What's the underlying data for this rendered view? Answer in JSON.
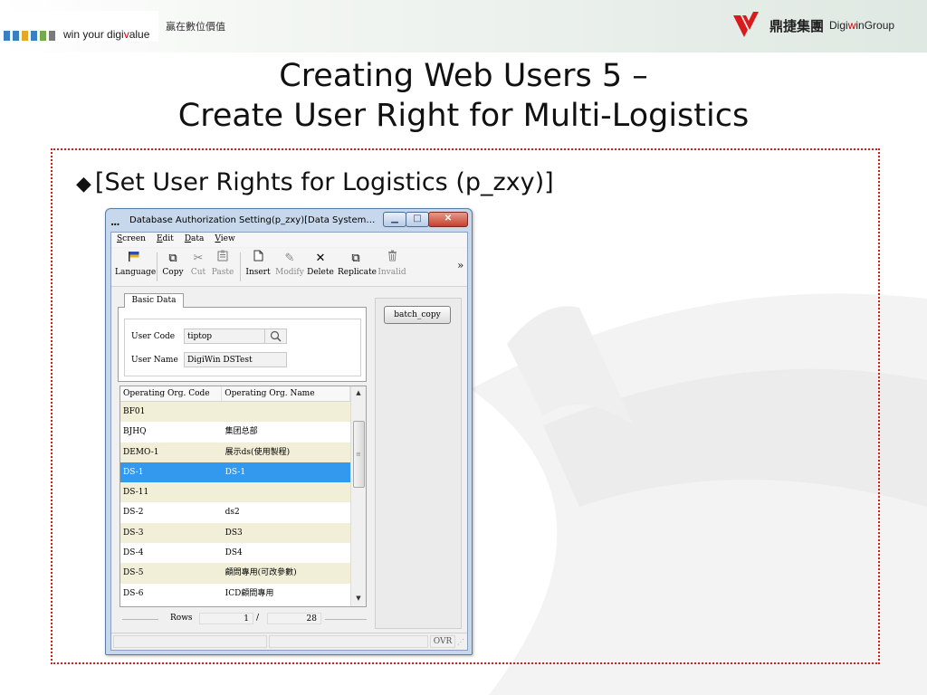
{
  "header": {
    "tagline_prefix": "win your digi",
    "tagline_highlight": "v",
    "tagline_suffix": "alue",
    "tagline_cn": "贏在數位價值",
    "brand_cn": "鼎捷集團",
    "brand_en_prefix": "Digi",
    "brand_en_highlight": "w",
    "brand_en_suffix": "inGroup",
    "square_colors": [
      "#3a7fc2",
      "#3a7fc2",
      "#e3a826",
      "#3a7fc2",
      "#76a84c",
      "#7a7a7a"
    ]
  },
  "slide": {
    "title_line1": "Creating Web Users 5 –",
    "title_line2": "Create User Right for Multi-Logistics",
    "bullet_symbol": "◆",
    "bullet_text": "[Set User Rights for Logistics (p_zxy)]"
  },
  "window": {
    "title_icon": "...",
    "title": "Database Authorization Setting(p_zxy)[Data Systems]...",
    "menu": [
      {
        "key": "S",
        "rest": "creen"
      },
      {
        "key": "E",
        "rest": "dit"
      },
      {
        "key": "D",
        "rest": "ata"
      },
      {
        "key": "V",
        "rest": "iew"
      }
    ],
    "toolbar": [
      {
        "icon": "flag-icon",
        "glyph": "⚑",
        "label": "Language",
        "enabled": true
      },
      {
        "icon": "copy-icon",
        "glyph": "⧉",
        "label": "Copy",
        "enabled": true
      },
      {
        "icon": "cut-icon",
        "glyph": "✂",
        "label": "Cut",
        "enabled": false
      },
      {
        "icon": "paste-icon",
        "glyph": "📋",
        "label": "Paste",
        "enabled": false
      },
      {
        "icon": "new-page-icon",
        "glyph": "🗋",
        "label": "Insert",
        "enabled": true
      },
      {
        "icon": "pencil-icon",
        "glyph": "✎",
        "label": "Modify",
        "enabled": false
      },
      {
        "icon": "delete-x-icon",
        "glyph": "✕",
        "label": "Delete",
        "enabled": true
      },
      {
        "icon": "replicate-icon",
        "glyph": "⧉",
        "label": "Replicate",
        "enabled": true
      },
      {
        "icon": "trash-icon",
        "glyph": "🗑",
        "label": "Invalid",
        "enabled": false
      }
    ],
    "toolbar_more": "»",
    "tab_basic": "Basic Data",
    "user_code_label": "User Code",
    "user_code_value": "tiptop",
    "user_name_label": "User Name",
    "user_name_value": "DigiWin DSTest",
    "batch_copy": "batch_copy",
    "grid": {
      "columns": [
        "Operating Org. Code",
        "Operating Org. Name"
      ],
      "rows": [
        [
          "BF01",
          ""
        ],
        [
          "BJHQ",
          "集团总部"
        ],
        [
          "DEMO-1",
          "展示ds(使用製程)"
        ],
        [
          "DS-1",
          "DS-1"
        ],
        [
          "DS-11",
          ""
        ],
        [
          "DS-2",
          "ds2"
        ],
        [
          "DS-3",
          "DS3"
        ],
        [
          "DS-4",
          "DS4"
        ],
        [
          "DS-5",
          "顧問專用(可改參數)"
        ],
        [
          "DS-6",
          "ICD顧問專用"
        ]
      ],
      "selected_index": 3
    },
    "rows_label": "Rows",
    "rows_current": "1",
    "rows_separator": "/",
    "rows_total": "28",
    "status_mode": "OVR"
  }
}
